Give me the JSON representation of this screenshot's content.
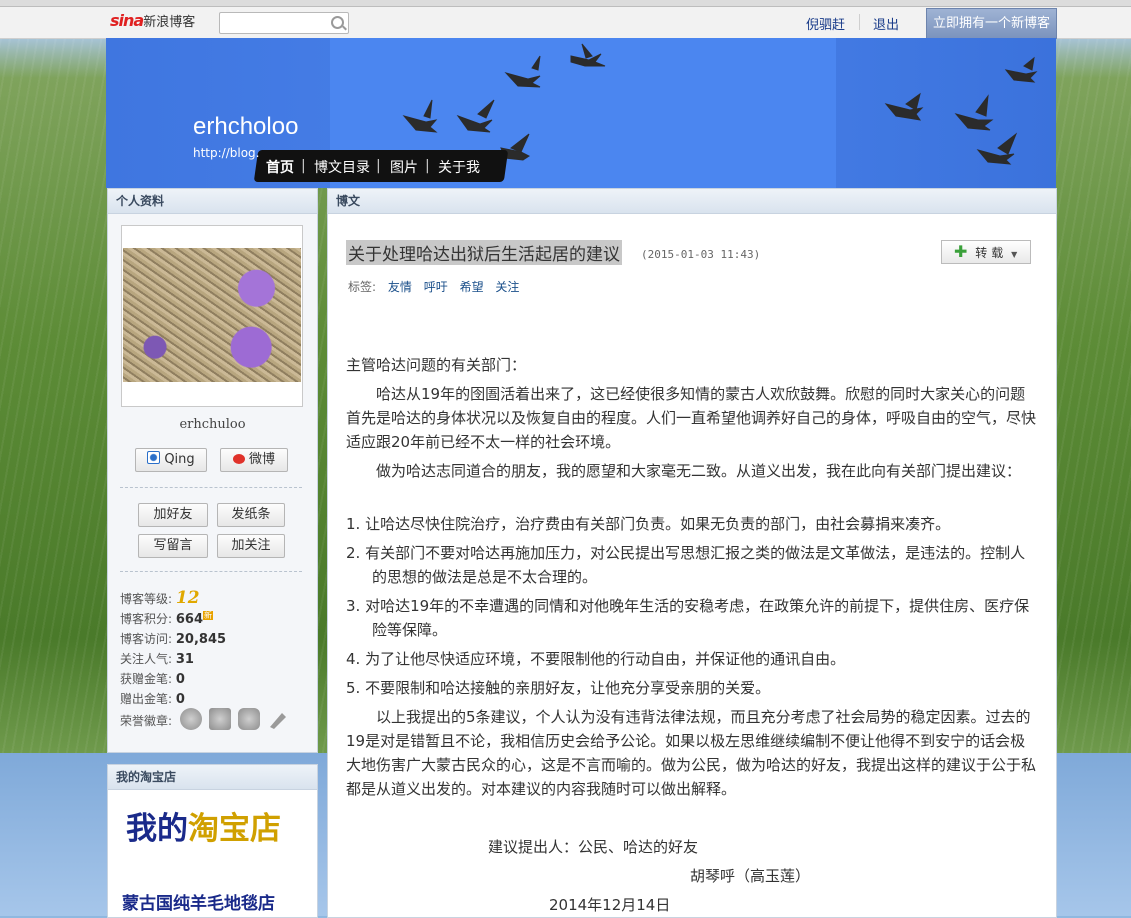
{
  "topbar": {
    "logo_sina": "sina",
    "logo_text": "新浪博客",
    "search_placeholder": "",
    "user_link": "倪驷赶",
    "logout": "退出",
    "new_blog_button": "立即拥有一个新博客"
  },
  "header": {
    "blog_title": "erhcholoo",
    "blog_url": "http://blog.",
    "nav": [
      "首页",
      "博文目录",
      "图片",
      "关于我"
    ]
  },
  "profile": {
    "panel_title": "个人资料",
    "username": "erhchuloo",
    "qing_button": "Qing",
    "weibo_button": "微博",
    "buttons": [
      "加好友",
      "发纸条",
      "写留言",
      "加关注"
    ],
    "stats": [
      {
        "label": "博客等级:",
        "value": "12"
      },
      {
        "label": "博客积分:",
        "value": "664"
      },
      {
        "label": "博客访问:",
        "value": "20,845"
      },
      {
        "label": "关注人气:",
        "value": "31"
      },
      {
        "label": "获赠金笔:",
        "value": "0"
      },
      {
        "label": "赠出金笔:",
        "value": "0"
      },
      {
        "label": "荣誉徽章:",
        "value": ""
      }
    ],
    "new_badge": "新"
  },
  "taobao": {
    "panel_title": "我的淘宝店",
    "banner1_a": "我的",
    "banner1_b": "淘宝店",
    "banner2": "蒙古国纯羊毛地毯店"
  },
  "article": {
    "panel_title": "博文",
    "title": "关于处理哈达出狱后生活起居的建议",
    "date": "(2015-01-03 11:43)",
    "zhuanzai": "转载",
    "tags_label": "标签:",
    "tags": [
      "友情",
      "呼吁",
      "希望",
      "关注"
    ],
    "greeting": "主管哈达问题的有关部门：",
    "para1": "哈达从19年的囹圄活着出来了，这已经使很多知情的蒙古人欢欣鼓舞。欣慰的同时大家关心的问题首先是哈达的身体状况以及恢复自由的程度。人们一直希望他调养好自己的身体，呼吸自由的空气，尽快适应跟20年前已经不太一样的社会环境。",
    "para2": "做为哈达志同道合的朋友，我的愿望和大家毫无二致。从道义出发，我在此向有关部门提出建议：",
    "items": [
      "1.   让哈达尽快住院治疗，治疗费由有关部门负责。如果无负责的部门，由社会募捐来凑齐。",
      "2.   有关部门不要对哈达再施加压力，对公民提出写思想汇报之类的做法是文革做法，是违法的。控制人的思想的做法是总是不太合理的。",
      "3.   对哈达19年的不幸遭遇的同情和对他晚年生活的安稳考虑，在政策允许的前提下，提供住房、医疗保险等保障。",
      "4.   为了让他尽快适应环境，不要限制他的行动自由，并保证他的通讯自由。",
      "5.   不要限制和哈达接触的亲朋好友，让他充分享受亲朋的关爱。"
    ],
    "para3": "以上我提出的5条建议，个人认为没有违背法律法规，而且充分考虑了社会局势的稳定因素。过去的19是对是错暂且不论，我相信历史会给予公论。如果以极左思维继续编制不便让他得不到安宁的话会极大地伤害广大蒙古民众的心，这是不言而喻的。做为公民，做为哈达的好友，我提出这样的建议于公于私都是从道义出发的。对本建议的内容我随时可以做出解释。",
    "signer": "建议提出人：公民、哈达的好友",
    "signer_name": "胡琴呼（高玉莲）",
    "sign_date": "2014年12月14日"
  }
}
